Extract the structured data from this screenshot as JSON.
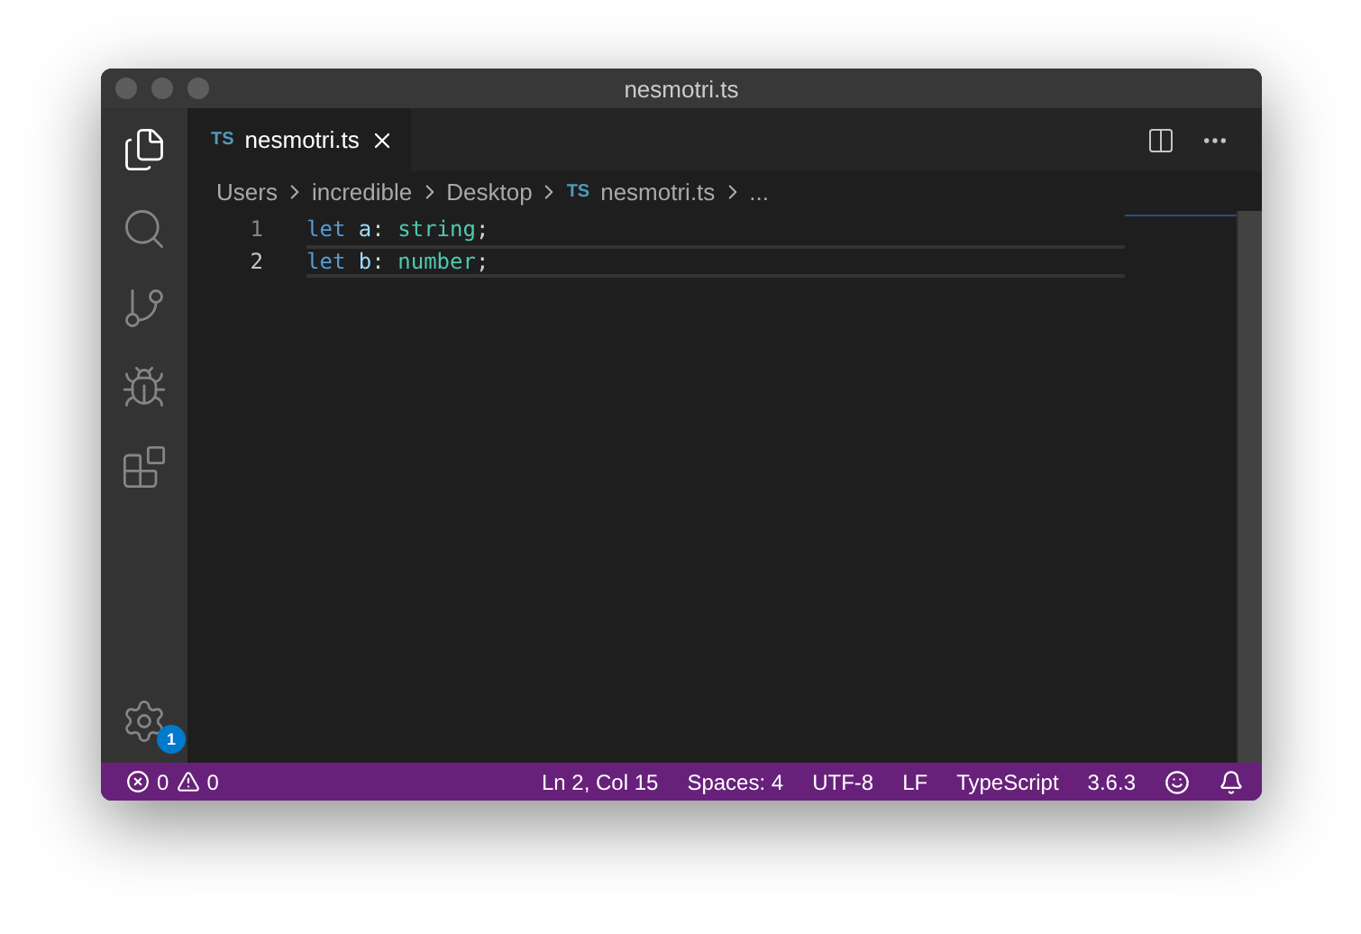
{
  "window": {
    "title": "nesmotri.ts"
  },
  "activity_bar": {
    "items": [
      {
        "kind": "files",
        "selected": true
      },
      {
        "kind": "search",
        "selected": false
      },
      {
        "kind": "source-control",
        "selected": false
      },
      {
        "kind": "debug",
        "selected": false
      },
      {
        "kind": "extensions",
        "selected": false
      }
    ],
    "settings_badge": "1"
  },
  "tabs": [
    {
      "badge": "TS",
      "label": "nesmotri.ts",
      "selected": true
    }
  ],
  "breadcrumbs": [
    {
      "label": "Users"
    },
    {
      "label": "incredible"
    },
    {
      "label": "Desktop"
    },
    {
      "badge": "TS",
      "label": "nesmotri.ts"
    },
    {
      "label": "..."
    }
  ],
  "code_lines": [
    {
      "number": "1",
      "current": false,
      "tokens": [
        {
          "kind": "keyword",
          "text": "let"
        },
        {
          "kind": "variable",
          "text": "a"
        },
        {
          "kind": "punct",
          "text": ":"
        },
        {
          "kind": "type",
          "text": "string"
        },
        {
          "kind": "punct",
          "text": ";"
        }
      ]
    },
    {
      "number": "2",
      "current": true,
      "tokens": [
        {
          "kind": "keyword",
          "text": "let"
        },
        {
          "kind": "variable",
          "text": "b"
        },
        {
          "kind": "punct",
          "text": ":"
        },
        {
          "kind": "type",
          "text": "number"
        },
        {
          "kind": "punct",
          "text": ";"
        }
      ]
    }
  ],
  "status_bar": {
    "errors": "0",
    "warnings": "0",
    "items": [
      "Ln 2, Col 15",
      "Spaces: 4",
      "UTF-8",
      "LF",
      "TypeScript",
      "3.6.3"
    ]
  }
}
